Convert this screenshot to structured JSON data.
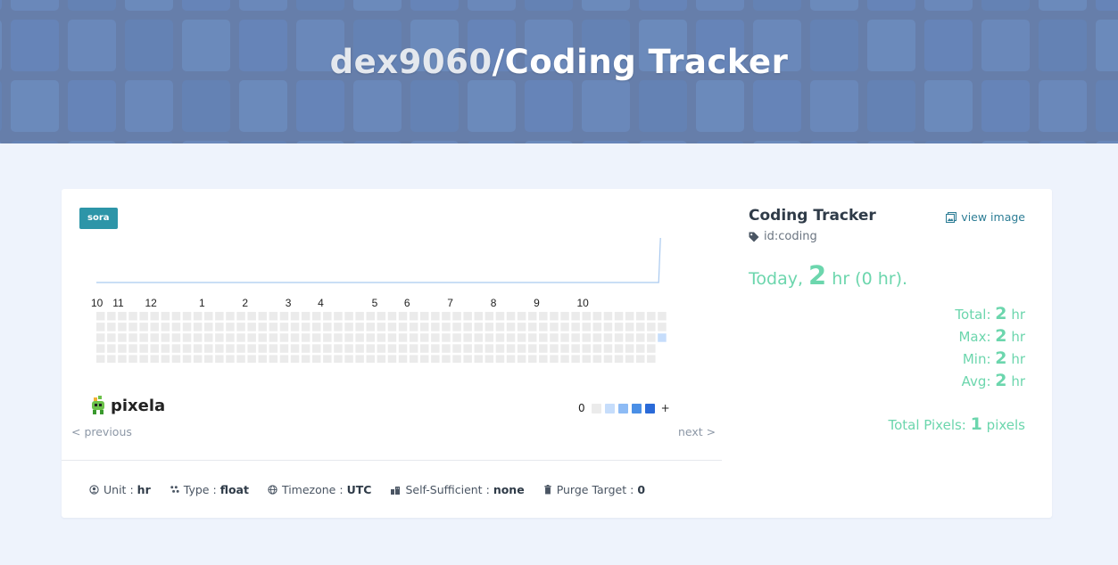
{
  "header": {
    "owner": "dex9060",
    "graph_name": "/Coding Tracker"
  },
  "badge": "sora",
  "graph": {
    "months": [
      "10",
      "11",
      "12",
      "1",
      "2",
      "3",
      "4",
      "5",
      "6",
      "7",
      "8",
      "9",
      "10"
    ],
    "colors": {
      "empty": "#ebebeb",
      "l1": "#c6ddfb",
      "l2": "#8dbbf5",
      "l3": "#4a8fe6",
      "l4": "#2a6ad8"
    },
    "filled_cell": {
      "week": 52,
      "day": 2,
      "level": "l1"
    }
  },
  "legend": {
    "min": "0",
    "max": "+"
  },
  "nav": {
    "previous": "< previous",
    "next": "next >"
  },
  "meta": {
    "unit_label": "Unit",
    "unit_value": "hr",
    "type_label": "Type",
    "type_value": "float",
    "timezone_label": "Timezone",
    "timezone_value": "UTC",
    "self_label": "Self-Sufficient",
    "self_value": "none",
    "purge_label": "Purge Target",
    "purge_value": "0"
  },
  "side": {
    "title": "Coding Tracker",
    "view_image": "view image",
    "id": "id:coding",
    "today_prefix": "Today,",
    "today_value": "2",
    "today_suffix": "hr (0 hr).",
    "stats": [
      {
        "label": "Total:",
        "value": "2",
        "unit": "hr"
      },
      {
        "label": "Max:",
        "value": "2",
        "unit": "hr"
      },
      {
        "label": "Min:",
        "value": "2",
        "unit": "hr"
      },
      {
        "label": "Avg:",
        "value": "2",
        "unit": "hr"
      }
    ],
    "total_pixels_label": "Total Pixels:",
    "total_pixels_value": "1",
    "total_pixels_unit": "pixels"
  },
  "brand": "pixela"
}
